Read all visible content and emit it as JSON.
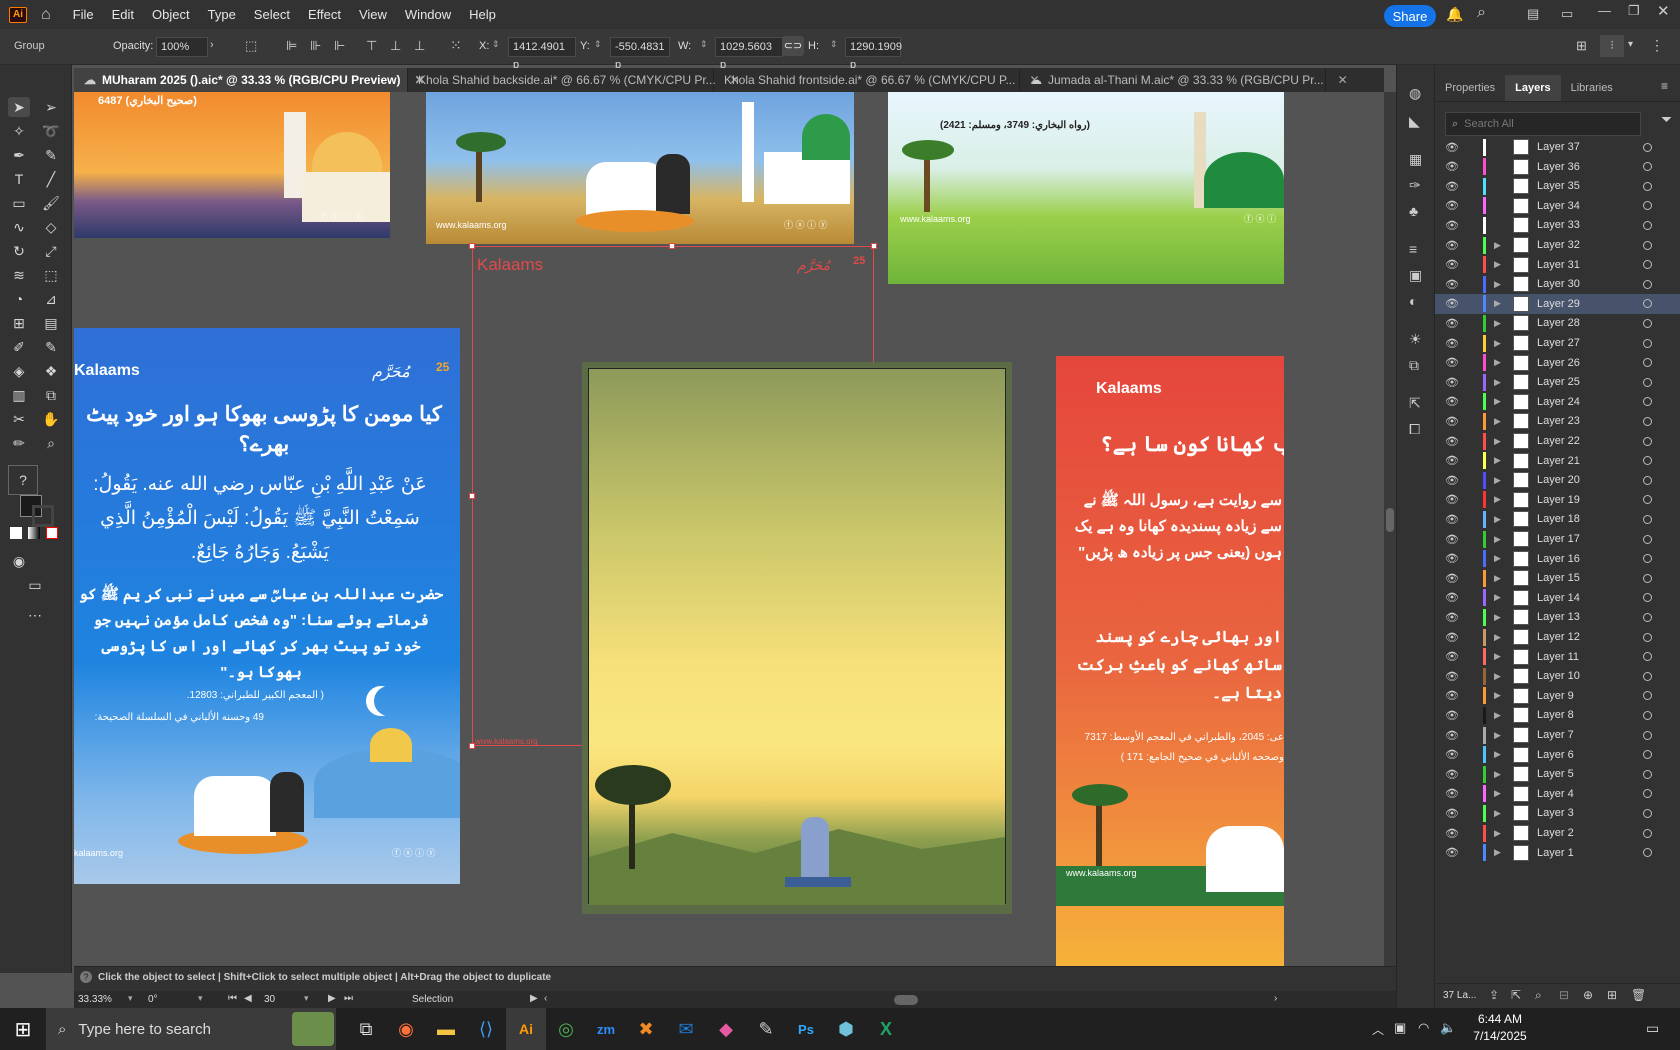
{
  "menubar": {
    "items": [
      "File",
      "Edit",
      "Object",
      "Type",
      "Select",
      "Effect",
      "View",
      "Window",
      "Help"
    ],
    "share_label": "Share"
  },
  "controlbar": {
    "object_type": "Group",
    "opacity_label": "Opacity:",
    "opacity_value": "100%",
    "x_label": "X:",
    "x_value": "1412.4901 p",
    "y_label": "Y:",
    "y_value": "-550.4831 p",
    "w_label": "W:",
    "w_value": "1029.5603 p",
    "h_label": "H:",
    "h_value": "1290.1909 p"
  },
  "tabs": [
    {
      "label": "MUharam 2025 ().aic* @ 33.33 % (RGB/CPU Preview)",
      "active": true
    },
    {
      "label": "Khola Shahid backside.ai* @ 66.67 % (CMYK/CPU Pr..."
    },
    {
      "label": "Khola Shahid frontside.ai* @ 66.67 % (CMYK/CPU P..."
    },
    {
      "label": "Jumada al-Thani M.aic* @ 33.33 % (RGB/CPU Pr..."
    }
  ],
  "panel": {
    "tabs": [
      "Properties",
      "Layers",
      "Libraries"
    ],
    "active_tab": "Layers",
    "search_placeholder": "Search All",
    "layer_count": "37 La...",
    "layers": [
      "Layer 37",
      "Layer 36",
      "Layer 35",
      "Layer 34",
      "Layer 33",
      "Layer 32",
      "Layer 31",
      "Layer 30",
      "Layer 29",
      "Layer 28",
      "Layer 27",
      "Layer 26",
      "Layer 25",
      "Layer 24",
      "Layer 23",
      "Layer 22",
      "Layer 21",
      "Layer 20",
      "Layer 19",
      "Layer 18",
      "Layer 17",
      "Layer 16",
      "Layer 15",
      "Layer 14",
      "Layer 13",
      "Layer 12",
      "Layer 11",
      "Layer 10",
      "Layer 9",
      "Layer 8",
      "Layer 7",
      "Layer 6",
      "Layer 5",
      "Layer 4",
      "Layer 3",
      "Layer 2",
      "Layer 1"
    ],
    "selected_layer": "Layer 29",
    "layer_colors": [
      "#ffffff",
      "#ff4dd0",
      "#4de1ff",
      "#ff66ff",
      "#ffffff",
      "#4dff4d",
      "#ff4d4d",
      "#4d6bff",
      "#4d88ff",
      "#33cc33",
      "#ffcc33",
      "#ff4dd0",
      "#9966ff",
      "#4dff4d",
      "#ff9933",
      "#ff4d4d",
      "#ffff4d",
      "#4d4dff",
      "#ff3333",
      "#66b3ff",
      "#33cc33",
      "#4d6bff",
      "#ff9933",
      "#9966ff",
      "#4dff4d",
      "#cc9966",
      "#ff6666",
      "#996633",
      "#ff9933",
      "#1a1a1a",
      "#aaaaaa",
      "#4dc3ff",
      "#33cc33",
      "#ff66ff",
      "#4dff4d",
      "#ff4d4d",
      "#4d88ff"
    ]
  },
  "status": {
    "hint": "Click the object to select  |  Shift+Click to select multiple object  |  Alt+Drag the object to duplicate",
    "zoom": "33.33%",
    "rotation": "0°",
    "artboard_number": "30",
    "tool": "Selection"
  },
  "artboards": {
    "top_left_ref": "6487 (صحيح البخاري)",
    "top_mid_url": "www.kalaams.org",
    "top_right_ref": "(رواه البخاري: 3749، ومسلم: 2421)",
    "top_right_url": "www.kalaams.org",
    "kalaams_logo": "Kalaams",
    "blue_heading": "کیا مومن کا پڑوسی بھوکا ہو اور خود پیٹ بھرے؟",
    "blue_arabic": "عَنْ عَبْدِ اللَّهِ بْنِ عبّاس رضي الله عنه. يَقُولُ: سَمِعْتُ النَّبِيَّ ﷺ يَقُولُ: لَيْسَ الْمُؤْمِنُ الَّذِي يَشْبَعُ. وَجَارُهُ جَائِعٌ.",
    "blue_urdu": "حضرت عبداللہ بن عباسؓ سے میں نے نبی کر یم ﷺ کو فرماتے ہوئے سنا: \"وہ شخص کامل مؤمن نہیں جو خود تو پیٹ بھر کر کھائے اور اس کا پڑوسی بھوکا ہو۔\"",
    "blue_ref1": "( المعجم الكبير للطبراني: 12803.",
    "blue_ref2": "49 وحسنه الألباني في السلسلة الصحيحة:",
    "blue_url": "kalaams.org",
    "muharram_badge": "25",
    "muharram_text": "مُحَرَّم",
    "selection_url": "www.kalaams.org",
    "red_heading": "ب کھانا کون سا ہے؟",
    "red_urdu1": "سے روایت ہے، رسول اللہ ﷺ نے سے زیادہ پسندیدہ کھانا وہ ہے یک ہوں (یعنی جس پر زیادہ ھ پڑیں\"",
    "red_urdu2": "اور بھائی چارے کو پسند ساتھ کھانے کو باعثِ برکت دیتا ہے۔",
    "red_ref1": "عی: 2045، والطبراني في المعجم الأوسط: 7317",
    "red_ref2": "وصححه الألباني في صحيح الجامع: 171 )",
    "red_url": "www.kalaams.org"
  },
  "taskbar": {
    "search_placeholder": "Type here to search",
    "time": "6:44 AM",
    "date": "7/14/2025"
  }
}
